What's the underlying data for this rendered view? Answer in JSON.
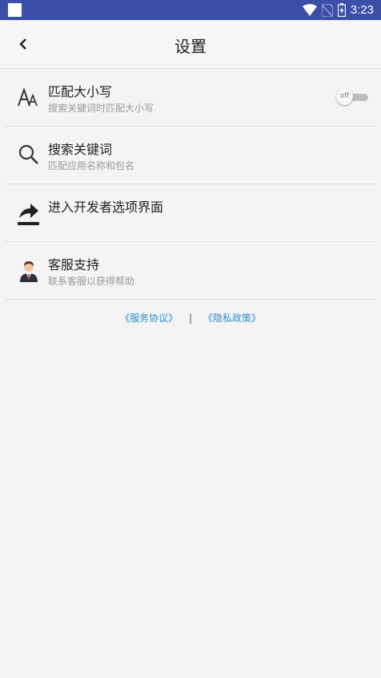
{
  "status_bar": {
    "time": "3:23"
  },
  "header": {
    "title": "设置"
  },
  "settings": [
    {
      "label": "匹配大小写",
      "sub": "搜索关键词时匹配大小写",
      "icon": "font-size-icon",
      "toggle": "off"
    },
    {
      "label": "搜索关键词",
      "sub": "匹配应用名称和包名",
      "icon": "search-icon"
    },
    {
      "label": "进入开发者选项界面",
      "sub": "",
      "icon": "share-arrow-icon"
    },
    {
      "label": "客服支持",
      "sub": "联系客服以获得帮助",
      "icon": "support-agent-icon"
    }
  ],
  "footer": {
    "terms": "《服务协议》",
    "separator": "|",
    "privacy": "《隐私政策》"
  },
  "colors": {
    "status_bar": "#3c4fa8",
    "link": "#2f8fc8"
  }
}
